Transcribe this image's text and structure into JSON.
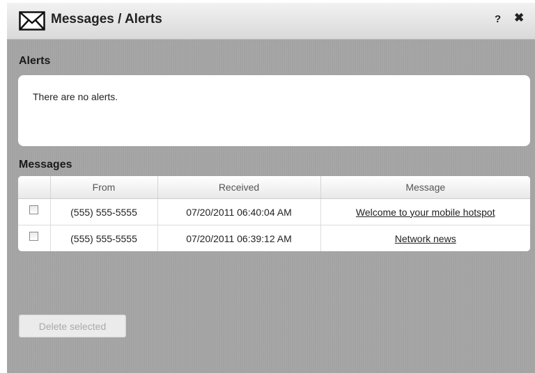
{
  "dialog": {
    "title": "Messages / Alerts",
    "help_label": "?",
    "close_label": "✖"
  },
  "alerts": {
    "heading": "Alerts",
    "empty_text": "There are no alerts."
  },
  "messages": {
    "heading": "Messages",
    "columns": [
      "",
      "From",
      "Received",
      "Message"
    ],
    "rows": [
      {
        "selected": false,
        "from": "(555) 555-5555",
        "received": "07/20/2011 06:40:04 AM",
        "message": "Welcome to your mobile hotspot"
      },
      {
        "selected": false,
        "from": "(555) 555-5555",
        "received": "07/20/2011 06:39:12 AM",
        "message": "Network news"
      }
    ],
    "delete_label": "Delete selected"
  }
}
